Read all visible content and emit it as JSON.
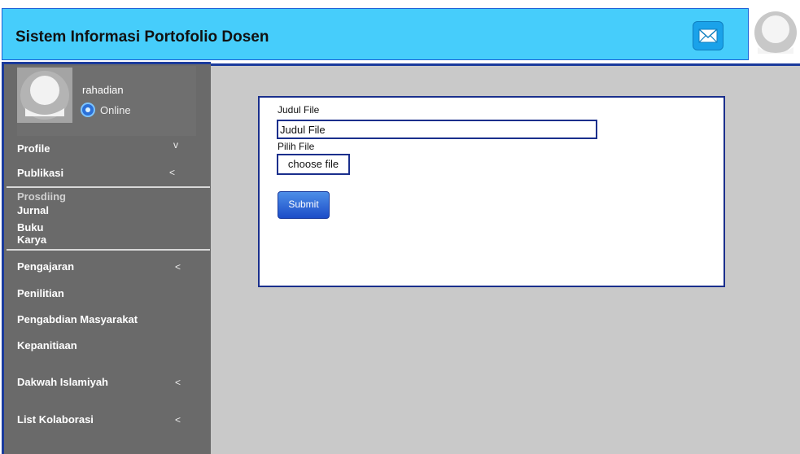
{
  "header": {
    "title": "Sistem Informasi Portofolio Dosen",
    "mail_icon": "mail-icon"
  },
  "profile": {
    "username": "rahadian",
    "status": "Online"
  },
  "sidebar": {
    "items": [
      {
        "label": "Profile",
        "arrow": "v"
      },
      {
        "label": "Publikasi",
        "arrow": "<"
      },
      {
        "label": "Pengajaran",
        "arrow": "<"
      },
      {
        "label": "Penilitian",
        "arrow": ""
      },
      {
        "label": "Pengabdian Masyarakat",
        "arrow": ""
      },
      {
        "label": "Kepanitiaan",
        "arrow": ""
      },
      {
        "label": "Dakwah Islamiyah",
        "arrow": "<"
      },
      {
        "label": "List Kolaborasi",
        "arrow": "<"
      }
    ],
    "publikasi_sub": [
      "Prosdiing",
      "Jurnal",
      "Buku",
      "Karya"
    ]
  },
  "form": {
    "judul_label": "Judul File",
    "judul_value": "Judul File",
    "pilih_label": "Pilih File",
    "choose_label": "choose file",
    "submit_label": "Submit"
  },
  "colors": {
    "header_bg": "#46cdfb",
    "sidebar_bg": "#6a6a6a",
    "main_bg": "#c9c9c9",
    "accent": "#1a2f8c"
  }
}
